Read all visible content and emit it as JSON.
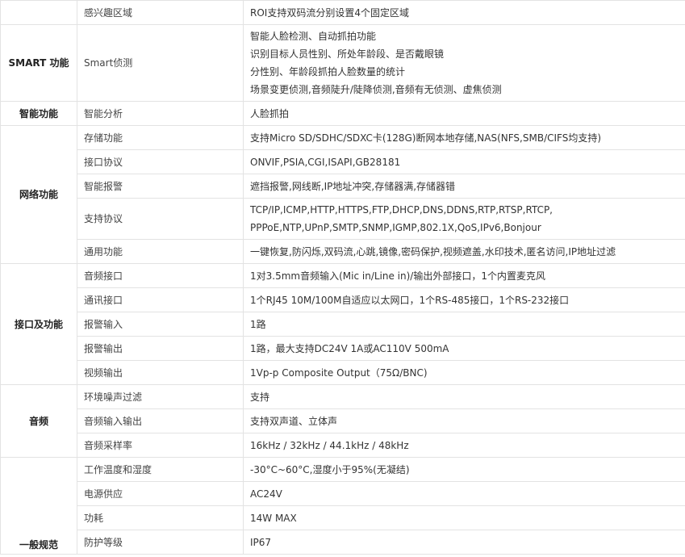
{
  "sections": [
    {
      "category": "",
      "rows": [
        {
          "item": "感兴趣区域",
          "value": [
            "ROI支持双码流分别设置4个固定区域"
          ]
        }
      ]
    },
    {
      "category": "SMART 功能",
      "rows": [
        {
          "item": "Smart侦测",
          "value": [
            "智能人脸检测、自动抓拍功能",
            "识别目标人员性别、所处年龄段、是否戴眼镜",
            "分性别、年龄段抓拍人脸数量的统计",
            "场景变更侦测,音频陡升/陡降侦测,音频有无侦测、虚焦侦测"
          ]
        }
      ]
    },
    {
      "category": "智能功能",
      "rows": [
        {
          "item": "智能分析",
          "value": [
            "人脸抓拍"
          ]
        }
      ]
    },
    {
      "category": "网络功能",
      "rows": [
        {
          "item": "存储功能",
          "value": [
            "支持Micro SD/SDHC/SDXC卡(128G)断网本地存储,NAS(NFS,SMB/CIFS均支持)"
          ]
        },
        {
          "item": "接口协议",
          "value": [
            "ONVIF,PSIA,CGI,ISAPI,GB28181"
          ]
        },
        {
          "item": "智能报警",
          "value": [
            "遮挡报警,网线断,IP地址冲突,存储器满,存储器错"
          ]
        },
        {
          "item": "支持协议",
          "value": [
            "TCP/IP,ICMP,HTTP,HTTPS,FTP,DHCP,DNS,DDNS,RTP,RTSP,RTCP,",
            "PPPoE,NTP,UPnP,SMTP,SNMP,IGMP,802.1X,QoS,IPv6,Bonjour"
          ]
        },
        {
          "item": "通用功能",
          "value": [
            "一键恢复,防闪烁,双码流,心跳,镜像,密码保护,视频遮盖,水印技术,匿名访问,IP地址过滤"
          ]
        }
      ]
    },
    {
      "category": "接口及功能",
      "rows": [
        {
          "item": "音频接口",
          "value": [
            "1对3.5mm音频输入(Mic in/Line in)/输出外部接口，1个内置麦克风"
          ]
        },
        {
          "item": "通讯接口",
          "value": [
            "1个RJ45 10M/100M自适应以太网口，1个RS-485接口，1个RS-232接口"
          ]
        },
        {
          "item": "报警输入",
          "value": [
            "1路"
          ]
        },
        {
          "item": "报警输出",
          "value": [
            "1路，最大支持DC24V 1A或AC110V 500mA"
          ]
        },
        {
          "item": "视频输出",
          "value": [
            "1Vp-p Composite Output（75Ω/BNC)"
          ]
        }
      ]
    },
    {
      "category": "音频",
      "rows": [
        {
          "item": "环境噪声过滤",
          "value": [
            "支持"
          ]
        },
        {
          "item": "音频输入输出",
          "value": [
            "支持双声道、立体声"
          ]
        },
        {
          "item": "音频采样率",
          "value": [
            "16kHz / 32kHz / 44.1kHz / 48kHz"
          ]
        }
      ]
    },
    {
      "category": "一般规范",
      "rows": [
        {
          "item": "工作温度和湿度",
          "value": [
            "-30°C~60°C,湿度小于95%(无凝结)"
          ]
        },
        {
          "item": "电源供应",
          "value": [
            "AC24V"
          ]
        },
        {
          "item": "功耗",
          "value": [
            "14W MAX"
          ]
        },
        {
          "item": "防护等级",
          "value": [
            "IP67"
          ]
        }
      ]
    }
  ]
}
